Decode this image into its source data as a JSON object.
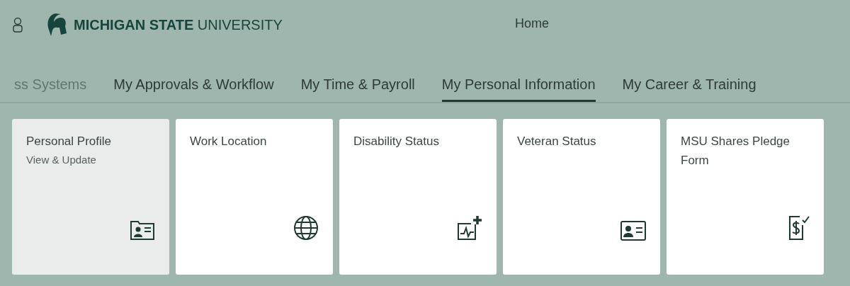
{
  "header": {
    "logo_text": "**MICHIGAN STATE** UNIVERSITY",
    "title": "Home"
  },
  "tabs": [
    {
      "label": "ss Systems",
      "selected": false,
      "faded": true
    },
    {
      "label": "My Approvals & Workflow",
      "selected": false,
      "faded": false
    },
    {
      "label": "My Time & Payroll",
      "selected": false,
      "faded": false
    },
    {
      "label": "My Personal Information",
      "selected": true,
      "faded": false
    },
    {
      "label": "My Career & Training",
      "selected": false,
      "faded": false
    }
  ],
  "tiles": [
    {
      "title": "Personal Profile",
      "subtitle": "View & Update",
      "highlighted": true
    },
    {
      "title": "Work Location",
      "highlighted": false
    },
    {
      "title": "Disability Status",
      "highlighted": false
    },
    {
      "title": "Veteran Status",
      "highlighted": false
    },
    {
      "title": "MSU Shares Pledge Form",
      "highlighted": false
    }
  ]
}
